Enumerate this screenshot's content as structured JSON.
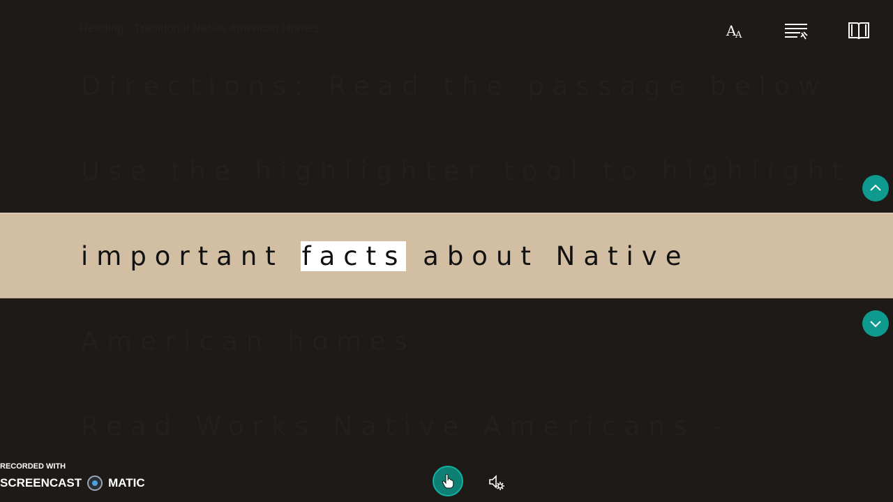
{
  "header": {
    "breadcrumb": "Reading - Traditional Native American Homes"
  },
  "toolbar": {
    "text_settings_icon": "text-size-icon",
    "line_mask_icon": "line-reader-icon",
    "dictionary_icon": "dictionary-icon"
  },
  "reader": {
    "lines": [
      "Directions: Read the passage below",
      "Use the highlighter tool to highlight",
      "American homes",
      "Read Works Native Americans -"
    ],
    "focus_line": {
      "before": "important ",
      "highlighted": "facts",
      "after": " about Native"
    },
    "scroll_up_icon": "chevron-up-icon",
    "scroll_down_icon": "chevron-down-icon"
  },
  "player": {
    "play_icon": "hand-pointer-icon",
    "audio_settings_icon": "speaker-settings-icon"
  },
  "watermark": {
    "line1": "RECORDED WITH",
    "brand_left": "SCREENCAST",
    "brand_right": "MATIC"
  },
  "colors": {
    "background": "#1d1a17",
    "focus_band": "#d1bea3",
    "highlight": "#ffffff",
    "accent": "#0e9a8e"
  }
}
